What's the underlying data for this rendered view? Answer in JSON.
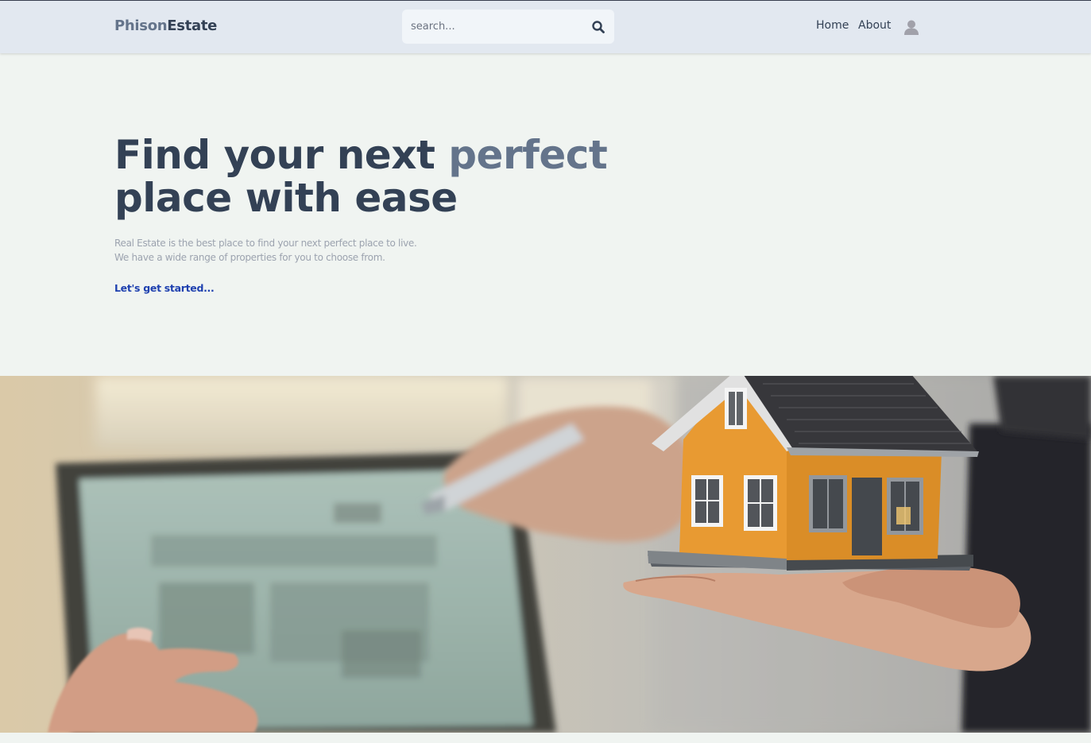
{
  "header": {
    "logo_part1": "Phison",
    "logo_part2": "Estate",
    "search_placeholder": "search...",
    "nav": {
      "home": "Home",
      "about": "About"
    }
  },
  "hero": {
    "title_part1": "Find your next ",
    "title_accent": "perfect",
    "title_part2": "place with ease",
    "desc_line1": "Real Estate is the best place to find your next perfect place to live.",
    "desc_line2": "We have a wide range of properties for you to choose from.",
    "cta": "Let's get started..."
  },
  "icons": [
    "search-icon",
    "user-avatar-icon"
  ],
  "colors": {
    "header_bg": "#e2e8f0",
    "page_bg": "#f0f4f1",
    "title": "#334155",
    "accent": "#64748b",
    "cta": "#1e40af",
    "house": "#f59e0b"
  }
}
